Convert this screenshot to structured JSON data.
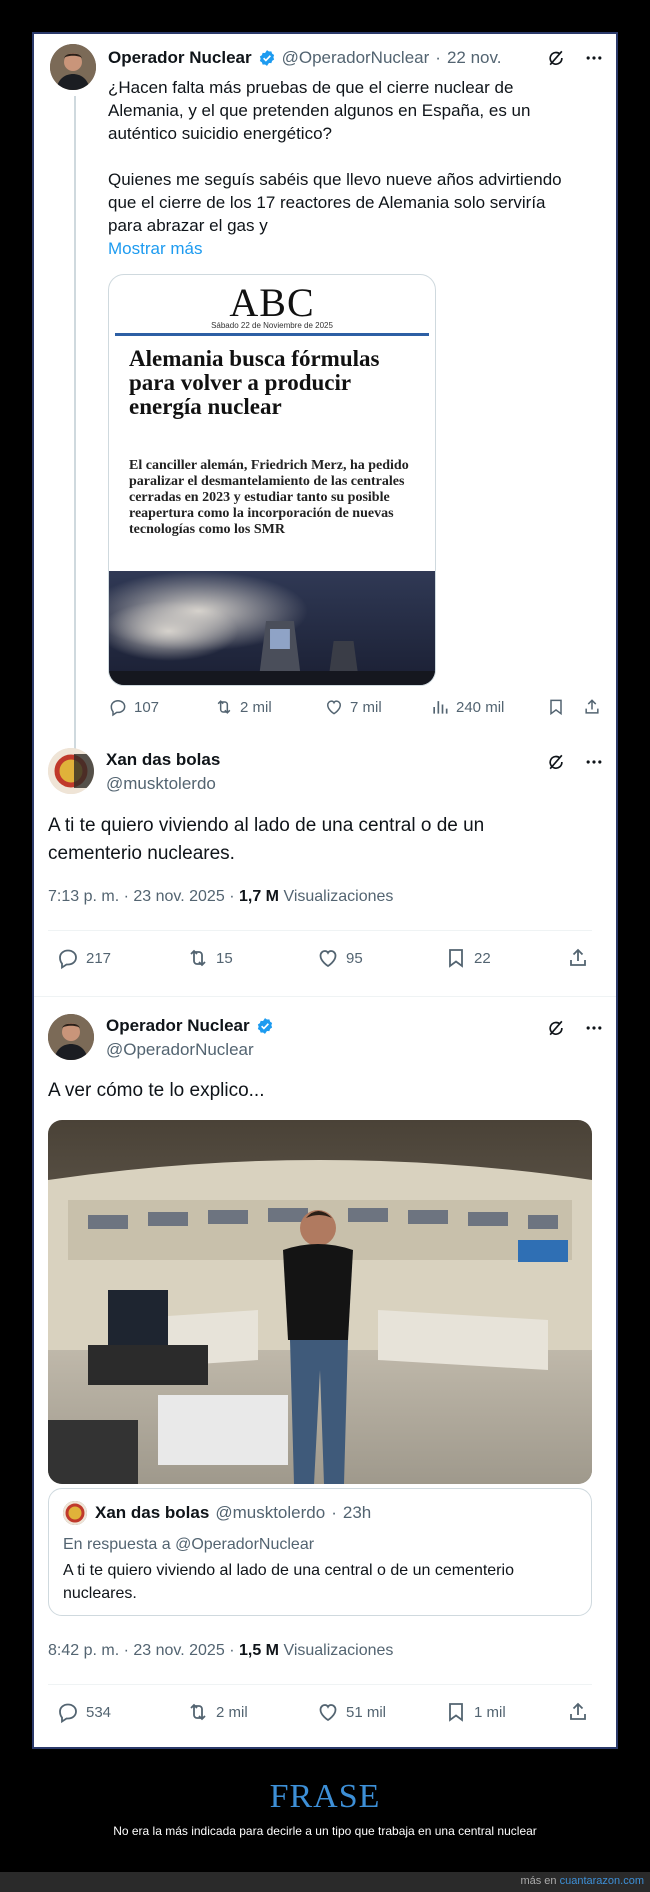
{
  "tweet1": {
    "name": "Operador Nuclear",
    "handle": "@OperadorNuclear",
    "dot": "·",
    "date": "22 nov.",
    "line1": "¿Hacen falta más pruebas de que el cierre nuclear de",
    "line2": "Alemania, y el que pretenden algunos en España, es un",
    "line3": "auténtico suicidio energético?",
    "line4": "Quienes me seguís sabéis que llevo nueve años advirtiendo",
    "line5": "que el cierre de los 17 reactores de Alemania solo serviría",
    "line6": "para abrazar el gas y",
    "show_more": "Mostrar más",
    "card": {
      "logo": "ABC",
      "date": "Sábado 22 de Noviembre de 2025",
      "headline": "Alemania busca fórmulas para volver a producir energía nuclear",
      "subhead": "El canciller alemán, Friedrich Merz, ha pedido paralizar el desmantelamiento de las centrales cerradas en 2023 y estudiar tanto su posible reapertura como la incorporación de nuevas tecnologías como los SMR"
    },
    "replies": "107",
    "reposts": "2 mil",
    "likes": "7 mil",
    "views": "240 mil"
  },
  "tweet2": {
    "name": "Xan das bolas",
    "handle": "@musktolerdo",
    "line1": "A ti te quiero viviendo al lado de una central o de un",
    "line2": "cementerio nucleares.",
    "time": "7:13 p. m.",
    "dot": "·",
    "date": "23 nov. 2025",
    "dot2": "·",
    "views": "1,7 M",
    "views_label": "Visualizaciones",
    "replies": "217",
    "reposts": "15",
    "likes": "95",
    "bookmarks": "22"
  },
  "tweet3": {
    "name": "Operador Nuclear",
    "handle": "@OperadorNuclear",
    "text": "A ver cómo te lo explico...",
    "quote": {
      "name": "Xan das bolas",
      "handle": "@musktolerdo",
      "dot": "·",
      "age": "23h",
      "reply_to": "En respuesta a @OperadorNuclear",
      "line1": "A ti te quiero viviendo al lado de una central o de un cementerio",
      "line2": "nucleares."
    },
    "time": "8:42 p. m.",
    "dot": "·",
    "date": "23 nov. 2025",
    "dot2": "·",
    "views": "1,5 M",
    "views_label": "Visualizaciones",
    "replies": "534",
    "reposts": "2 mil",
    "likes": "51 mil",
    "bookmarks": "1 mil"
  },
  "footer": {
    "title": "FRASE",
    "description": "No era la más indicada para decirle a un tipo que trabaja en una central nuclear",
    "more_prefix": "más en",
    "more_site": "cuantarazon.com"
  },
  "colors": {
    "link": "#1d9bf0",
    "verified": "#1d9bf0",
    "muted": "#536471",
    "footer_title": "#3d8fd6"
  }
}
